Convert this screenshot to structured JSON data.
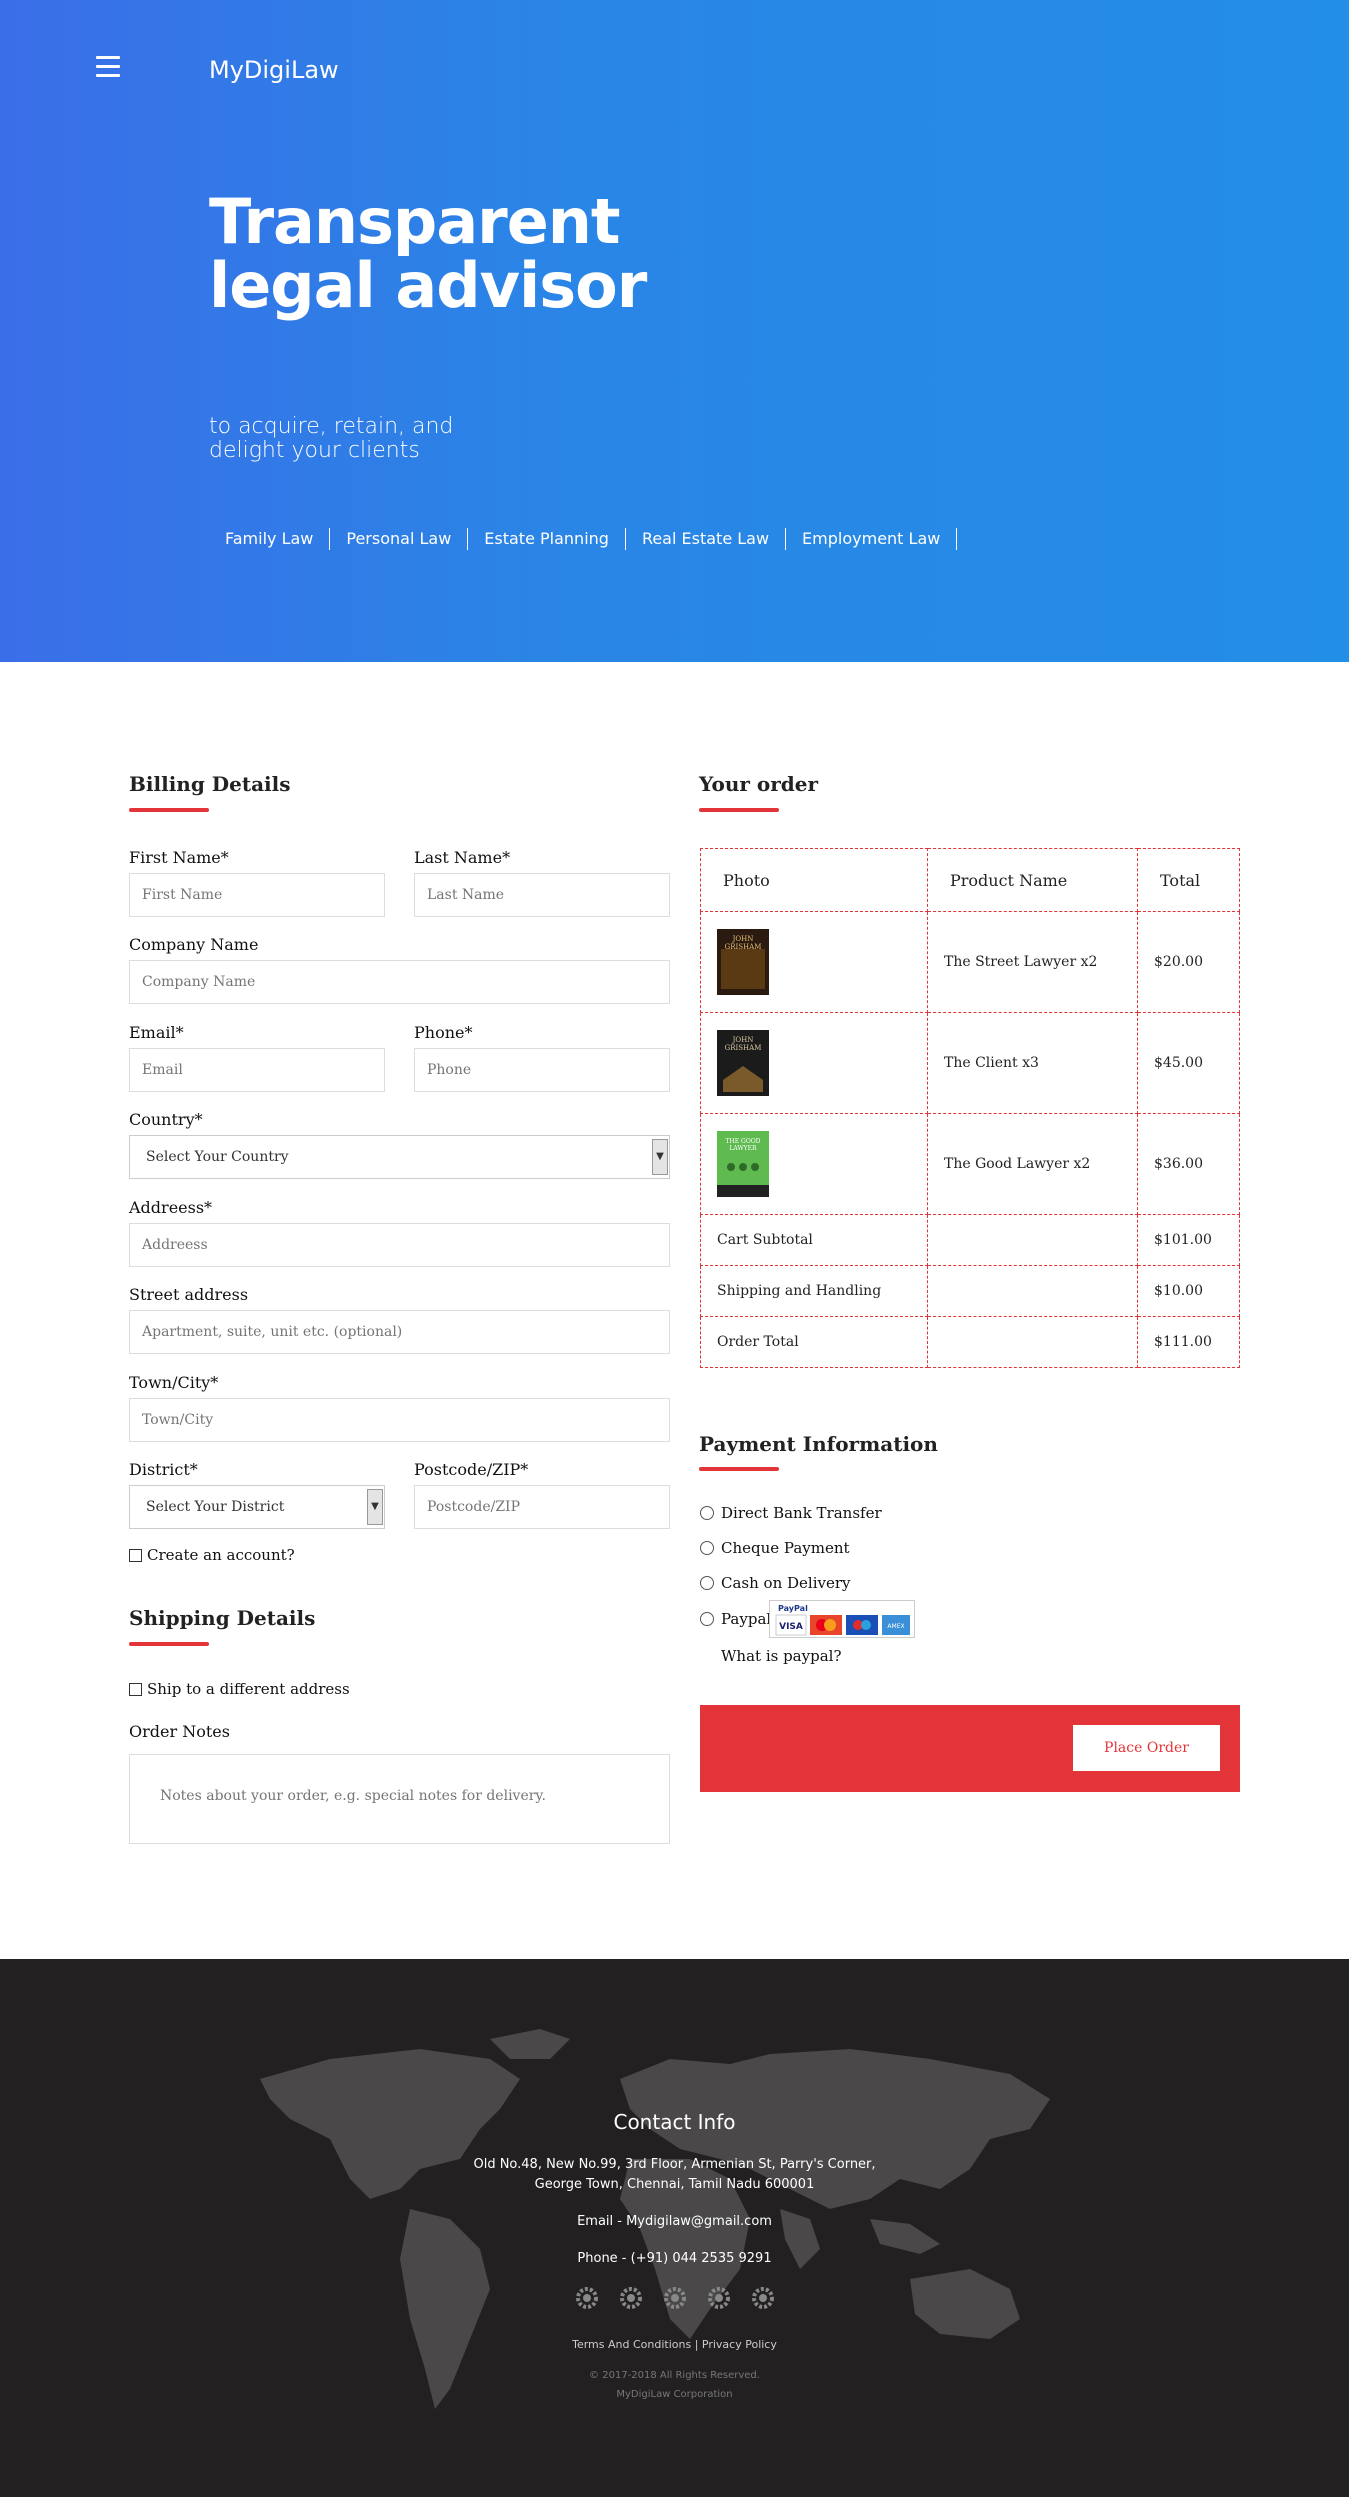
{
  "header": {
    "brand": "MyDigiLaw",
    "hero_title": "Transparent legal advisor",
    "hero_subtitle": "to acquire, retain, and delight your clients",
    "nav": [
      "Family Law",
      "Personal Law",
      "Estate Planning",
      "Real Estate Law",
      "Employment Law"
    ]
  },
  "billing": {
    "title": "Billing Details",
    "first_name_label": "First Name*",
    "first_name_placeholder": "First Name",
    "last_name_label": "Last Name*",
    "last_name_placeholder": "Last Name",
    "company_label": "Company Name",
    "company_placeholder": "Company Name",
    "email_label": "Email*",
    "email_placeholder": "Email",
    "phone_label": "Phone*",
    "phone_placeholder": "Phone",
    "country_label": "Country*",
    "country_value": "Select Your Country",
    "address_label": "Addreess*",
    "address_placeholder": "Addreess",
    "street_label": "Street address",
    "street_placeholder": "Apartment, suite, unit etc. (optional)",
    "town_label": "Town/City*",
    "town_placeholder": "Town/City",
    "district_label": "District*",
    "district_value": "Select Your District",
    "postcode_label": "Postcode/ZIP*",
    "postcode_placeholder": "Postcode/ZIP",
    "create_account": "Create an account?"
  },
  "shipping": {
    "title": "Shipping Details",
    "ship_different": "Ship to a different address",
    "notes_label": "Order Notes",
    "notes_placeholder": "Notes about your order, e.g. special notes for delivery."
  },
  "order": {
    "title": "Your order",
    "headers": [
      "Photo",
      "Product Name",
      "Total"
    ],
    "items": [
      {
        "name": "The Street Lawyer x2",
        "total": "$20.00",
        "cover_color": "#2a1a10",
        "cover_text": "JOHN GRISHAM"
      },
      {
        "name": "The Client x3",
        "total": "$45.00",
        "cover_color": "#1b1b1b",
        "cover_text": "JOHN GRISHAM"
      },
      {
        "name": "The Good Lawyer x2",
        "total": "$36.00",
        "cover_color": "#5fbb4f",
        "cover_text": "THE GOOD LAWYER"
      }
    ],
    "summary": [
      {
        "label": "Cart Subtotal",
        "value": "$101.00"
      },
      {
        "label": "Shipping and Handling",
        "value": "$10.00"
      },
      {
        "label": "Order Total",
        "value": "$111.00"
      }
    ]
  },
  "payment": {
    "title": "Payment Information",
    "options": [
      "Direct Bank Transfer",
      "Cheque Payment",
      "Cash on Delivery",
      "Paypal"
    ],
    "paypal_link": "What is paypal?",
    "place_order": "Place Order",
    "accent": "#e3343a"
  },
  "footer": {
    "title": "Contact Info",
    "address_line1": "Old No.48, New No.99, 3rd Floor, Armenian St, Parry's Corner,",
    "address_line2": "George Town, Chennai, Tamil Nadu 600001",
    "email": "Email - Mydigilaw@gmail.com",
    "phone": "Phone - (+91) 044 2535 9291",
    "social_icons": [
      "gear-icon",
      "gear-icon",
      "gear-icon",
      "gear-icon",
      "gear-icon"
    ],
    "links": "Terms And Conditions | Privacy Policy",
    "copyright": "© 2017-2018 All Rights Reserved.",
    "corp": "MyDigiLaw Corporation"
  }
}
